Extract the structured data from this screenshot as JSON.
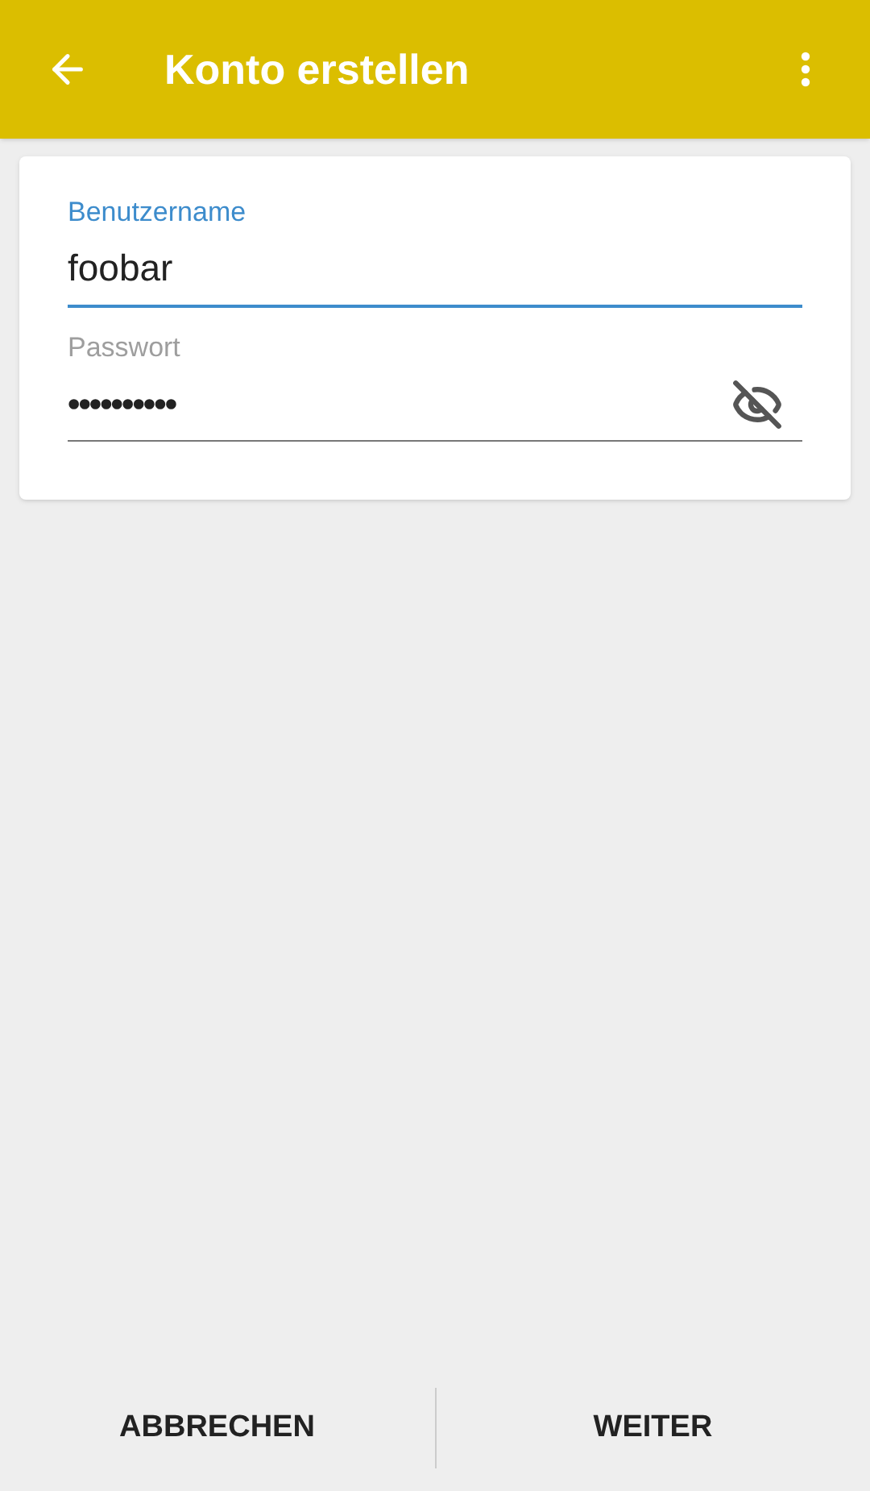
{
  "app_bar": {
    "title": "Konto erstellen"
  },
  "fields": [
    {
      "label": "Benutzername",
      "value": "foobar",
      "focused": true,
      "kind": "text"
    },
    {
      "label": "Passwort",
      "value": "••••••••••",
      "focused": false,
      "kind": "password"
    }
  ],
  "buttons": [
    "ABBRECHEN",
    "WEITER"
  ]
}
